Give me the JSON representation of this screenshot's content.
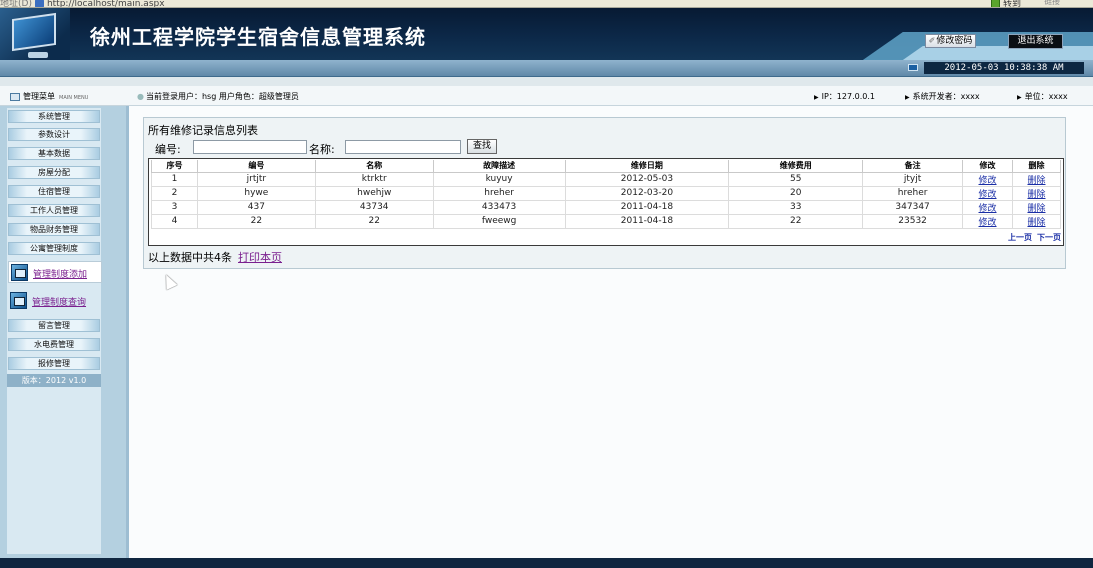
{
  "browser": {
    "address_label": "地址(D)",
    "url": "http://localhost/main.aspx",
    "go_label": "转到",
    "links_label": "链接"
  },
  "header": {
    "title": "徐州工程学院学生宿舍信息管理系统",
    "change_password": "修改密码",
    "exit": "退出系统"
  },
  "datetime": "2012-05-03 10:38:38 AM",
  "status": {
    "menu_title": "管理菜单",
    "menu_en": "MAIN MENU",
    "user_text": "当前登录用户：hsg   用户角色：超级管理员",
    "ip": "IP：127.0.0.1",
    "developer": "系统开发者：xxxx",
    "unit": "单位：xxxx"
  },
  "sidebar": {
    "items": [
      "系统管理",
      "参数设计",
      "基本数据",
      "房屋分配",
      "住宿管理",
      "工作人员管理",
      "物品财务管理",
      "公寓管理制度"
    ],
    "sub_items": [
      "管理制度添加",
      "管理制度查询"
    ],
    "items2": [
      "留言管理",
      "水电费管理",
      "报修管理"
    ],
    "version": "版本：2012 v1.0"
  },
  "panel": {
    "title": "所有维修记录信息列表",
    "label_code": "编号:",
    "label_name": "名称:",
    "code_value": "",
    "name_value": "",
    "search_button": "查找",
    "columns": [
      "序号",
      "编号",
      "名称",
      "故障描述",
      "维修日期",
      "维修费用",
      "备注",
      "修改",
      "删除"
    ],
    "rows": [
      [
        "1",
        "jrtjtr",
        "ktrktr",
        "kuyuy",
        "2012-05-03",
        "55",
        "jtyjt",
        "修改",
        "删除"
      ],
      [
        "2",
        "hywe",
        "hwehjw",
        "hreher",
        "2012-03-20",
        "20",
        "hreher",
        "修改",
        "删除"
      ],
      [
        "3",
        "437",
        "43734",
        "433473",
        "2011-04-18",
        "33",
        "347347",
        "修改",
        "删除"
      ],
      [
        "4",
        "22",
        "22",
        "fweewg",
        "2011-04-18",
        "22",
        "23532",
        "修改",
        "删除"
      ]
    ],
    "prev_page": "上一页",
    "next_page": "下一页",
    "summary": "以上数据中共4条",
    "print": "打印本页"
  }
}
